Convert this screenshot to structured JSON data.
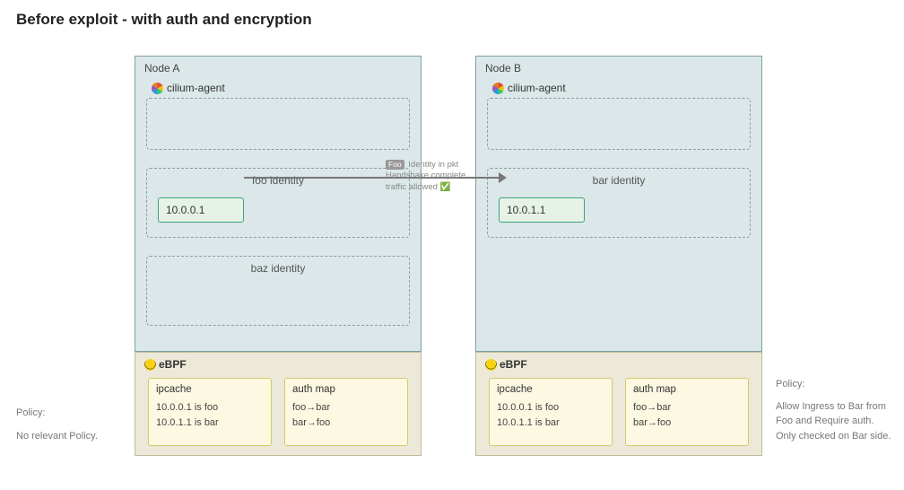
{
  "title": "Before exploit - with auth and encryption",
  "nodeA": {
    "title": "Node A",
    "agent": "cilium-agent",
    "foo": {
      "label": "foo identity",
      "ip": "10.0.0.1"
    },
    "baz": {
      "label": "baz identity"
    }
  },
  "nodeB": {
    "title": "Node B",
    "agent": "cilium-agent",
    "bar": {
      "label": "bar identity",
      "ip": "10.0.1.1"
    }
  },
  "arrow": {
    "tag": "Foo",
    "line1": "Identity in pkt",
    "line2": "Handshake complete,",
    "line3": "traffic allowed ✅"
  },
  "ebpfA": {
    "label": "eBPF",
    "ipcache": {
      "title": "ipcache",
      "l1": "10.0.0.1 is foo",
      "l2": "10.0.1.1 is bar"
    },
    "authmap": {
      "title": "auth map",
      "l1": "foo→bar",
      "l2": "bar→foo"
    }
  },
  "ebpfB": {
    "label": "eBPF",
    "ipcache": {
      "title": "ipcache",
      "l1": "10.0.0.1 is foo",
      "l2": "10.0.1.1 is bar"
    },
    "authmap": {
      "title": "auth map",
      "l1": "foo→bar",
      "l2": "bar→foo"
    }
  },
  "policyLeft": {
    "heading": "Policy:",
    "body": "No relevant Policy."
  },
  "policyRight": {
    "heading": "Policy:",
    "l1": "Allow Ingress to Bar from Foo and Require auth.",
    "l2": "Only checked on Bar side."
  }
}
